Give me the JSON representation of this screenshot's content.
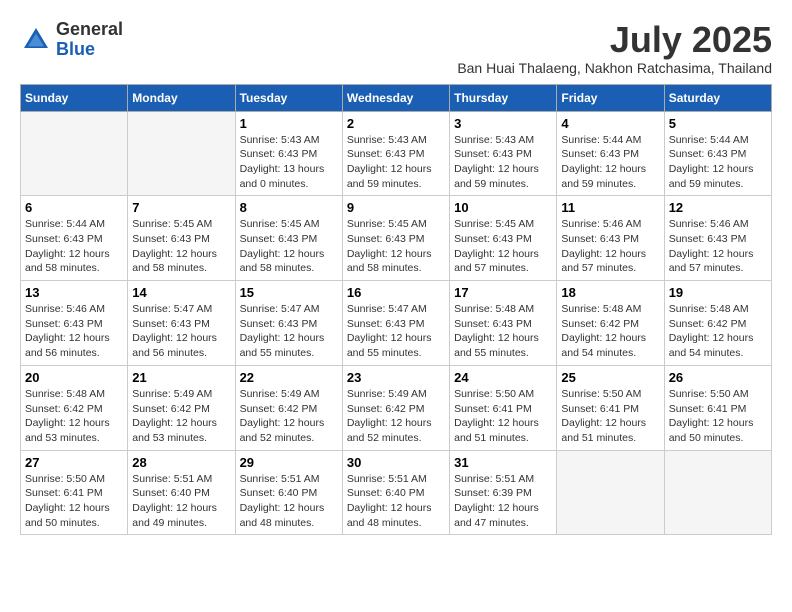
{
  "logo": {
    "general": "General",
    "blue": "Blue"
  },
  "title": "July 2025",
  "location": "Ban Huai Thalaeng, Nakhon Ratchasima, Thailand",
  "days_of_week": [
    "Sunday",
    "Monday",
    "Tuesday",
    "Wednesday",
    "Thursday",
    "Friday",
    "Saturday"
  ],
  "weeks": [
    [
      {
        "day": "",
        "info": ""
      },
      {
        "day": "",
        "info": ""
      },
      {
        "day": "1",
        "info": "Sunrise: 5:43 AM\nSunset: 6:43 PM\nDaylight: 13 hours\nand 0 minutes."
      },
      {
        "day": "2",
        "info": "Sunrise: 5:43 AM\nSunset: 6:43 PM\nDaylight: 12 hours\nand 59 minutes."
      },
      {
        "day": "3",
        "info": "Sunrise: 5:43 AM\nSunset: 6:43 PM\nDaylight: 12 hours\nand 59 minutes."
      },
      {
        "day": "4",
        "info": "Sunrise: 5:44 AM\nSunset: 6:43 PM\nDaylight: 12 hours\nand 59 minutes."
      },
      {
        "day": "5",
        "info": "Sunrise: 5:44 AM\nSunset: 6:43 PM\nDaylight: 12 hours\nand 59 minutes."
      }
    ],
    [
      {
        "day": "6",
        "info": "Sunrise: 5:44 AM\nSunset: 6:43 PM\nDaylight: 12 hours\nand 58 minutes."
      },
      {
        "day": "7",
        "info": "Sunrise: 5:45 AM\nSunset: 6:43 PM\nDaylight: 12 hours\nand 58 minutes."
      },
      {
        "day": "8",
        "info": "Sunrise: 5:45 AM\nSunset: 6:43 PM\nDaylight: 12 hours\nand 58 minutes."
      },
      {
        "day": "9",
        "info": "Sunrise: 5:45 AM\nSunset: 6:43 PM\nDaylight: 12 hours\nand 58 minutes."
      },
      {
        "day": "10",
        "info": "Sunrise: 5:45 AM\nSunset: 6:43 PM\nDaylight: 12 hours\nand 57 minutes."
      },
      {
        "day": "11",
        "info": "Sunrise: 5:46 AM\nSunset: 6:43 PM\nDaylight: 12 hours\nand 57 minutes."
      },
      {
        "day": "12",
        "info": "Sunrise: 5:46 AM\nSunset: 6:43 PM\nDaylight: 12 hours\nand 57 minutes."
      }
    ],
    [
      {
        "day": "13",
        "info": "Sunrise: 5:46 AM\nSunset: 6:43 PM\nDaylight: 12 hours\nand 56 minutes."
      },
      {
        "day": "14",
        "info": "Sunrise: 5:47 AM\nSunset: 6:43 PM\nDaylight: 12 hours\nand 56 minutes."
      },
      {
        "day": "15",
        "info": "Sunrise: 5:47 AM\nSunset: 6:43 PM\nDaylight: 12 hours\nand 55 minutes."
      },
      {
        "day": "16",
        "info": "Sunrise: 5:47 AM\nSunset: 6:43 PM\nDaylight: 12 hours\nand 55 minutes."
      },
      {
        "day": "17",
        "info": "Sunrise: 5:48 AM\nSunset: 6:43 PM\nDaylight: 12 hours\nand 55 minutes."
      },
      {
        "day": "18",
        "info": "Sunrise: 5:48 AM\nSunset: 6:42 PM\nDaylight: 12 hours\nand 54 minutes."
      },
      {
        "day": "19",
        "info": "Sunrise: 5:48 AM\nSunset: 6:42 PM\nDaylight: 12 hours\nand 54 minutes."
      }
    ],
    [
      {
        "day": "20",
        "info": "Sunrise: 5:48 AM\nSunset: 6:42 PM\nDaylight: 12 hours\nand 53 minutes."
      },
      {
        "day": "21",
        "info": "Sunrise: 5:49 AM\nSunset: 6:42 PM\nDaylight: 12 hours\nand 53 minutes."
      },
      {
        "day": "22",
        "info": "Sunrise: 5:49 AM\nSunset: 6:42 PM\nDaylight: 12 hours\nand 52 minutes."
      },
      {
        "day": "23",
        "info": "Sunrise: 5:49 AM\nSunset: 6:42 PM\nDaylight: 12 hours\nand 52 minutes."
      },
      {
        "day": "24",
        "info": "Sunrise: 5:50 AM\nSunset: 6:41 PM\nDaylight: 12 hours\nand 51 minutes."
      },
      {
        "day": "25",
        "info": "Sunrise: 5:50 AM\nSunset: 6:41 PM\nDaylight: 12 hours\nand 51 minutes."
      },
      {
        "day": "26",
        "info": "Sunrise: 5:50 AM\nSunset: 6:41 PM\nDaylight: 12 hours\nand 50 minutes."
      }
    ],
    [
      {
        "day": "27",
        "info": "Sunrise: 5:50 AM\nSunset: 6:41 PM\nDaylight: 12 hours\nand 50 minutes."
      },
      {
        "day": "28",
        "info": "Sunrise: 5:51 AM\nSunset: 6:40 PM\nDaylight: 12 hours\nand 49 minutes."
      },
      {
        "day": "29",
        "info": "Sunrise: 5:51 AM\nSunset: 6:40 PM\nDaylight: 12 hours\nand 48 minutes."
      },
      {
        "day": "30",
        "info": "Sunrise: 5:51 AM\nSunset: 6:40 PM\nDaylight: 12 hours\nand 48 minutes."
      },
      {
        "day": "31",
        "info": "Sunrise: 5:51 AM\nSunset: 6:39 PM\nDaylight: 12 hours\nand 47 minutes."
      },
      {
        "day": "",
        "info": ""
      },
      {
        "day": "",
        "info": ""
      }
    ]
  ]
}
